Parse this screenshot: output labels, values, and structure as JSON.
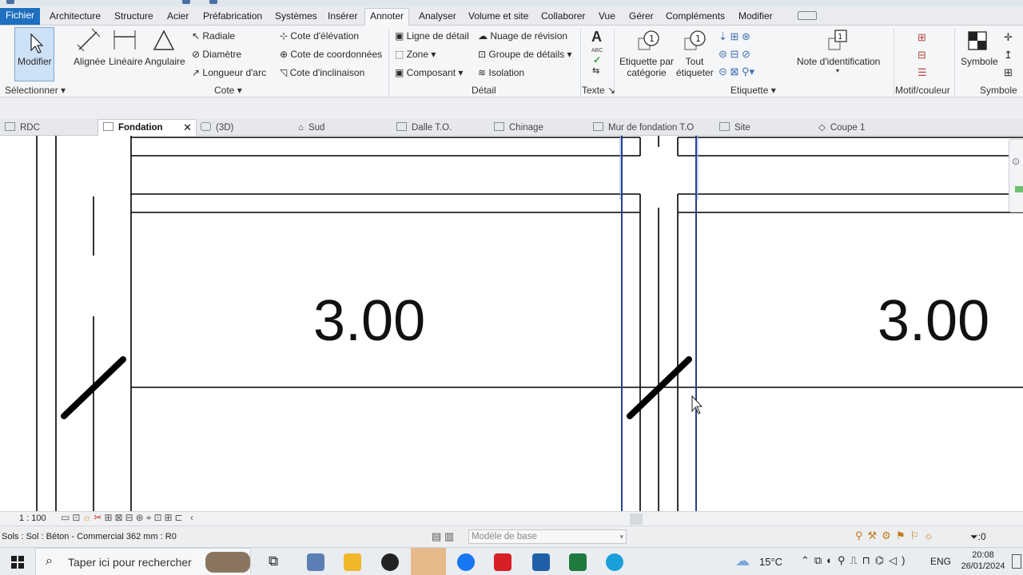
{
  "ribbon_tabs": {
    "file": "Fichier",
    "items": [
      "Architecture",
      "Structure",
      "Acier",
      "Préfabrication",
      "Systèmes",
      "Insérer",
      "Annoter",
      "Analyser",
      "Volume et site",
      "Collaborer",
      "Vue",
      "Gérer",
      "Compléments",
      "Modifier"
    ],
    "active": "Annoter"
  },
  "ribbon": {
    "modify": "Modifier",
    "select_panel": "Sélectionner",
    "aligned": "Alignée",
    "linear": "Linéaire",
    "angular": "Angulaire",
    "radial": "Radiale",
    "diameter": "Diamètre",
    "arc_length": "Longueur d'arc",
    "spot_elevation": "Cote  d'élévation",
    "spot_coordinate": "Cote  de coordonnées",
    "spot_slope": "Cote  d'inclinaison",
    "dimension_panel": "Cote",
    "detail_line": "Ligne de détail",
    "region": "Zone",
    "component": "Composant",
    "revision_cloud": "Nuage de révision",
    "detail_group": "Groupe de détails",
    "insulation": "Isolation",
    "detail_panel": "Détail",
    "text_panel": "Texte",
    "tag_by_category": "Etiquette par catégorie",
    "tag_all": "Tout étiqueter",
    "keynote": "Note d'identification",
    "tag_panel": "Etiquette",
    "pattern_color_panel": "Motif/couleur",
    "symbol": "Symbole",
    "symbol_panel": "Symbole",
    "text_icon": "A",
    "abc_icon": "ABC"
  },
  "view_tabs": [
    {
      "label": "RDC",
      "active": false
    },
    {
      "label": "Fondation",
      "active": true
    },
    {
      "label": "(3D)",
      "active": false
    },
    {
      "label": "Sud",
      "active": false
    },
    {
      "label": "Dalle T.O.",
      "active": false
    },
    {
      "label": "Chinage",
      "active": false
    },
    {
      "label": "Mur de fondation T.O",
      "active": false
    },
    {
      "label": "Site",
      "active": false
    },
    {
      "label": "Coupe 1",
      "active": false
    }
  ],
  "drawing": {
    "label_left": "3.00",
    "label_right": "3.00",
    "line_color": "#000000",
    "highlight_color": "#2a3f8f"
  },
  "view_control": {
    "scale": "1 : 100"
  },
  "status": {
    "text": "Sols : Sol : Béton - Commercial 362 mm : R0",
    "workset": "Modèle de base",
    "filter_count": ":0"
  },
  "taskbar": {
    "search_placeholder": "Taper ici pour rechercher",
    "temperature": "15°C",
    "lang": "ENG",
    "time": "20:08",
    "date": "26/01/2024"
  }
}
